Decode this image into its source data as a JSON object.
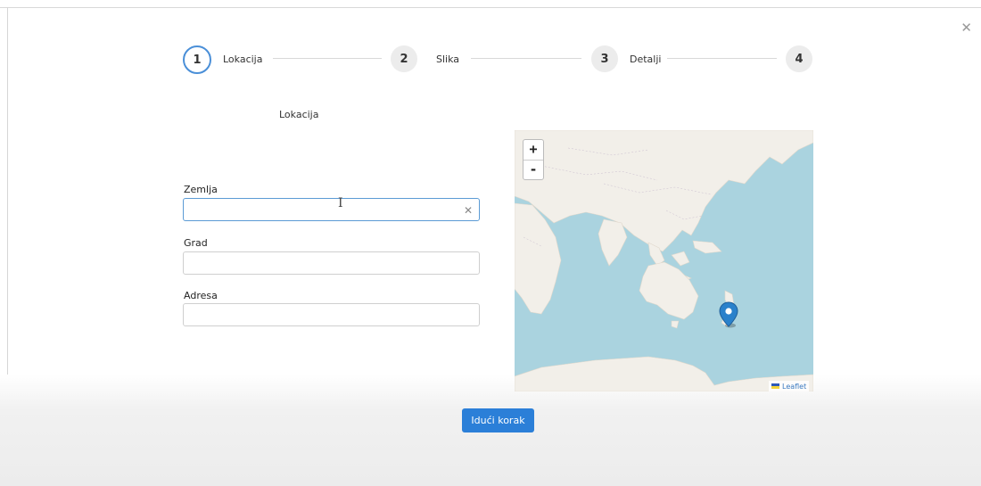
{
  "dialog": {
    "close_icon": "close-icon"
  },
  "stepper": {
    "steps": [
      {
        "number": "1",
        "label": "Lokacija",
        "active": true
      },
      {
        "number": "2",
        "label": "Slika",
        "active": false
      },
      {
        "number": "3",
        "label": "Detalji",
        "active": false
      },
      {
        "number": "4",
        "label": "",
        "active": false
      }
    ]
  },
  "form": {
    "section_title": "Lokacija",
    "fields": [
      {
        "label": "Zemlja",
        "value": ""
      },
      {
        "label": "Grad",
        "value": ""
      },
      {
        "label": "Adresa",
        "value": ""
      }
    ],
    "clear_icon": "close-icon"
  },
  "map": {
    "zoom_in": "+",
    "zoom_out": "-",
    "attribution": "Leaflet",
    "marker_icon": "map-marker-icon",
    "colors": {
      "water": "#aad3df",
      "land": "#f2efe9",
      "marker": "#2a81cb"
    }
  },
  "footer": {
    "next_label": "Idući korak",
    "button_color": "#2b7fd8"
  }
}
